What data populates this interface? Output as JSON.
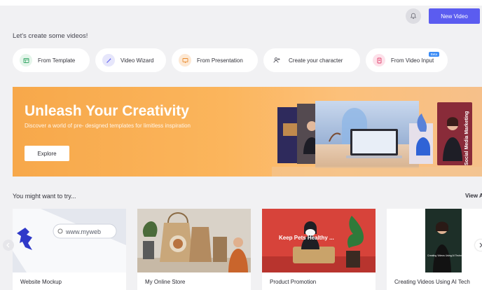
{
  "header": {
    "new_video_label": "New Video",
    "icons": {
      "notification": "bell-icon"
    }
  },
  "greeting": "Let's create some videos!",
  "quick_actions": [
    {
      "label": "From Template",
      "icon": "template-icon",
      "color": "#e4f5ea"
    },
    {
      "label": "Video Wizard",
      "icon": "wizard-icon",
      "color": "#e6e6fb"
    },
    {
      "label": "From Presentation",
      "icon": "presentation-icon",
      "color": "#fde8d3"
    },
    {
      "label": "Create your character",
      "icon": "character-icon",
      "color": "#ffffff"
    },
    {
      "label": "From Video Input",
      "icon": "video-input-icon",
      "color": "#fde1ea",
      "badge": "Beta"
    }
  ],
  "hero": {
    "title": "Unleash Your Creativity",
    "subtitle": "Discover a world of pre- designed templates for limitless inspiration",
    "cta": "Explore",
    "art_text": "Social Media Marketing",
    "accent": "#f7a84a"
  },
  "suggestions": {
    "title": "You might want to try...",
    "view_all": "View All",
    "cards": [
      {
        "label": "Website Mockup",
        "thumb_text": "www.myweb"
      },
      {
        "label": "My Online Store",
        "thumb_text": ""
      },
      {
        "label": "Product Promotion",
        "thumb_text": "Keep Pets Healthy ..."
      },
      {
        "label": "Creating Videos Using AI Tech",
        "thumb_text": "Creating Videos Using AI Technology"
      }
    ]
  },
  "colors": {
    "primary": "#5b5cf0",
    "background": "#f1f1f3"
  }
}
